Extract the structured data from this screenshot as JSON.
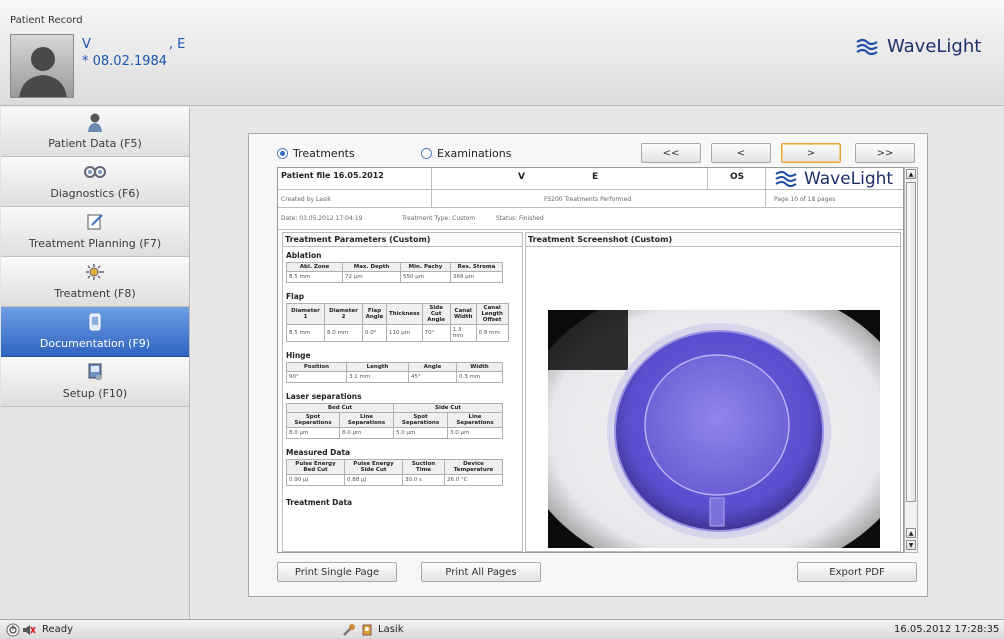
{
  "header": {
    "title": "Patient Record",
    "patient_last": "V",
    "patient_first": ", E",
    "dob": "* 08.02.1984",
    "brand": "WaveLight"
  },
  "sidebar": {
    "items": [
      {
        "label": "Patient Data (F5)",
        "icon": "person-icon"
      },
      {
        "label": "Diagnostics (F6)",
        "icon": "diagnostics-icon"
      },
      {
        "label": "Treatment Planning (F7)",
        "icon": "planning-icon"
      },
      {
        "label": "Treatment (F8)",
        "icon": "laser-icon"
      },
      {
        "label": "Documentation (F9)",
        "icon": "document-icon",
        "active": true
      },
      {
        "label": "Setup (F10)",
        "icon": "setup-icon"
      }
    ]
  },
  "dialog": {
    "radio_treatments": "Treatments",
    "radio_examinations": "Examinations",
    "selected": "Treatments",
    "nav": {
      "first": "<<",
      "prev": "<",
      "next": ">",
      "last": ">>"
    },
    "print_single": "Print Single Page",
    "print_all": "Print All Pages",
    "export_pdf": "Export PDF"
  },
  "doc": {
    "patient_file": "Patient file 16.05.2012",
    "name_last": "V",
    "name_first": "E",
    "eye": "OS",
    "brand": "WaveLight",
    "created_by": "Created by Lasik",
    "performed": "FS200 Treatments Performed",
    "page": "Page 10 of 18 pages",
    "date": "Date: 03.05.2012 17:04:19",
    "type": "Treatment Type: Custom",
    "status": "Status: Finished",
    "params_title": "Treatment Parameters (Custom)",
    "shot_title": "Treatment Screenshot (Custom)",
    "ablation": {
      "title": "Ablation",
      "headers": [
        "Abl. Zone",
        "Max. Depth",
        "Min. Pachy",
        "Res. Stroma"
      ],
      "values": [
        "8.5 mm",
        "72 µm",
        "550 µm",
        "368 µm"
      ]
    },
    "flap": {
      "title": "Flap",
      "headers": [
        "Diameter 1",
        "Diameter 2",
        "Flap Angle",
        "Thickness",
        "Side Cut Angle",
        "Canal Width",
        "Canal Length Offset"
      ],
      "values": [
        "8.5 mm",
        "8.0 mm",
        "0.0°",
        "110 µm",
        "70°",
        "1.3 mm",
        "0.8 mm"
      ]
    },
    "hinge": {
      "title": "Hinge",
      "headers": [
        "Position",
        "Length",
        "Angle",
        "Width"
      ],
      "values": [
        "90°",
        "3.1 mm",
        "45°",
        "0.3 mm"
      ]
    },
    "laser": {
      "title": "Laser separations",
      "groups": [
        "Bed Cut",
        "Side Cut"
      ],
      "headers": [
        "Spot Separations",
        "Line Separations",
        "Spot Separations",
        "Line Separations"
      ],
      "values": [
        "8.0 µm",
        "8.0 µm",
        "5.0 µm",
        "3.0 µm"
      ]
    },
    "measured": {
      "title": "Measured Data",
      "headers": [
        "Pulse Energy Bed Cut",
        "Pulse Energy Side Cut",
        "Suction Time",
        "Device Temperature"
      ],
      "values": [
        "0.90 µJ",
        "0.88 µJ",
        "30.0 s",
        "26.0 °C"
      ]
    },
    "treatment_data": "Treatment Data"
  },
  "status": {
    "ready": "Ready",
    "user": "Lasik",
    "datetime": "16.05.2012 17:28:35"
  },
  "colors": {
    "active_nav": "#3b72cc",
    "brand_blue": "#1d2f6b",
    "name_blue": "#1b55b5"
  }
}
